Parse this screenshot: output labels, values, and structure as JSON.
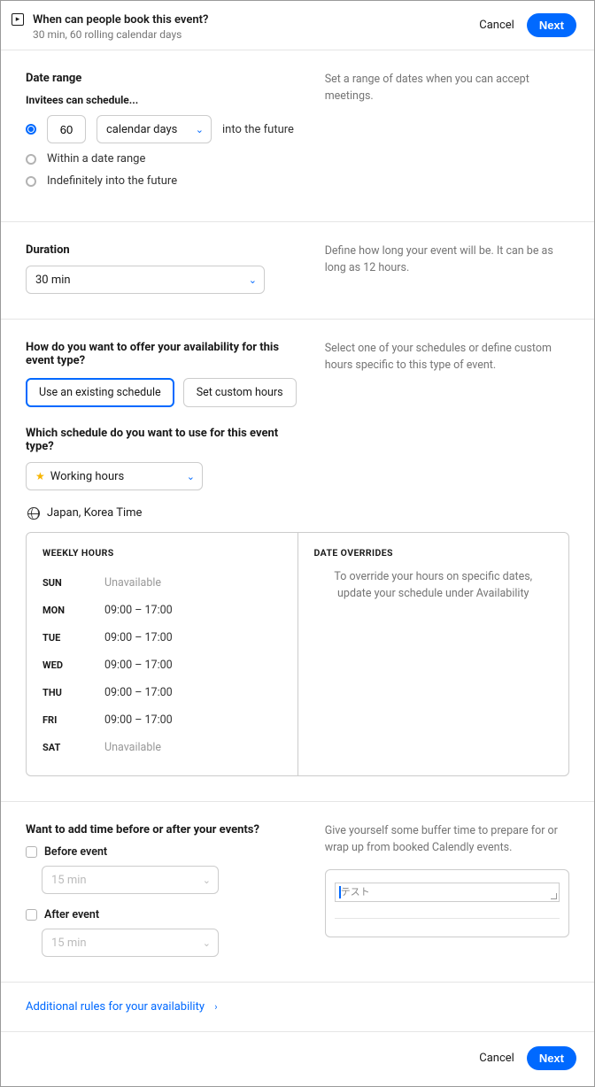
{
  "header": {
    "title": "When can people book this event?",
    "subtitle": "30 min, 60 rolling calendar days",
    "cancel": "Cancel",
    "next": "Next"
  },
  "dateRange": {
    "title": "Date range",
    "sub": "Invitees can schedule...",
    "help": "Set a range of dates when you can accept meetings.",
    "numValue": "60",
    "unit": "calendar days",
    "suffix": "into the future",
    "opt2": "Within a date range",
    "opt3": "Indefinitely into the future"
  },
  "duration": {
    "title": "Duration",
    "value": "30 min",
    "help": "Define how long your event will be. It can be as long as 12 hours."
  },
  "availability": {
    "q1": "How do you want to offer your availability for this event type?",
    "help": "Select one of your schedules or define custom hours specific to this type of event.",
    "tab1": "Use an existing schedule",
    "tab2": "Set custom hours",
    "q2": "Which schedule do you want to use for this event type?",
    "scheduleName": "Working hours",
    "timezone": "Japan, Korea Time",
    "weeklyHead": "WEEKLY HOURS",
    "overrideHead": "DATE OVERRIDES",
    "overrideMsg": "To override your hours on specific dates, update your schedule under Availability",
    "days": [
      {
        "d": "SUN",
        "v": "Unavailable",
        "u": true
      },
      {
        "d": "MON",
        "v": "09:00 – 17:00",
        "u": false
      },
      {
        "d": "TUE",
        "v": "09:00 – 17:00",
        "u": false
      },
      {
        "d": "WED",
        "v": "09:00 – 17:00",
        "u": false
      },
      {
        "d": "THU",
        "v": "09:00 – 17:00",
        "u": false
      },
      {
        "d": "FRI",
        "v": "09:00 – 17:00",
        "u": false
      },
      {
        "d": "SAT",
        "v": "Unavailable",
        "u": true
      }
    ]
  },
  "buffer": {
    "q": "Want to add time before or after your events?",
    "help": "Give yourself some buffer time to prepare for or wrap up from booked Calendly events.",
    "before": "Before event",
    "beforeVal": "15 min",
    "after": "After event",
    "afterVal": "15 min",
    "noteText": "テスト"
  },
  "collapse": {
    "label": "Additional rules for your availability"
  },
  "footer": {
    "cancel": "Cancel",
    "next": "Next"
  }
}
